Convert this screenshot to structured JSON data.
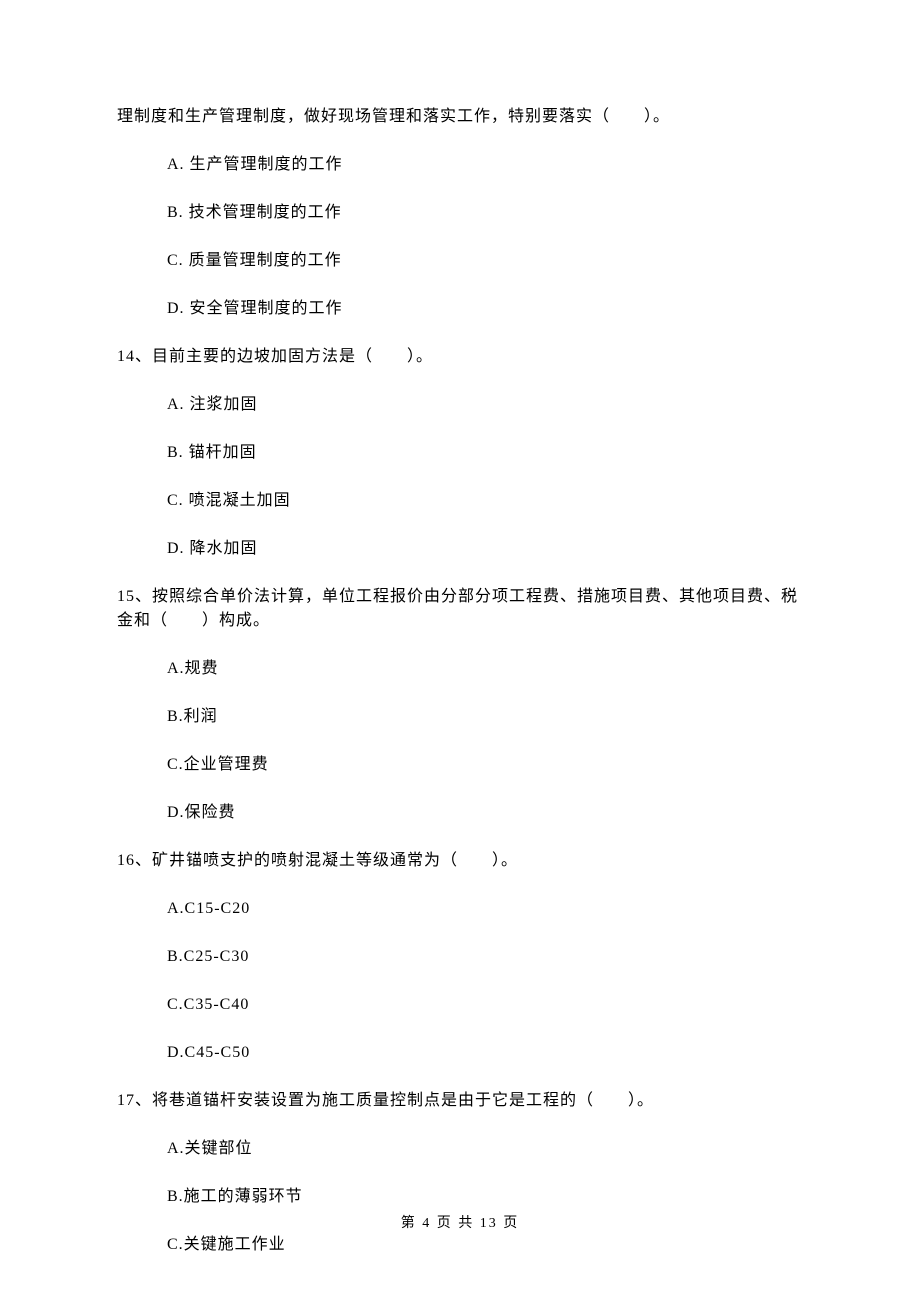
{
  "intro": "理制度和生产管理制度，做好现场管理和落实工作，特别要落实（　　）。",
  "q13_options": {
    "a": "A. 生产管理制度的工作",
    "b": "B. 技术管理制度的工作",
    "c": "C. 质量管理制度的工作",
    "d": "D. 安全管理制度的工作"
  },
  "q14": {
    "text": "14、目前主要的边坡加固方法是（　　）。",
    "a": "A. 注浆加固",
    "b": "B. 锚杆加固",
    "c": "C. 喷混凝土加固",
    "d": "D. 降水加固"
  },
  "q15": {
    "text": "15、按照综合单价法计算，单位工程报价由分部分项工程费、措施项目费、其他项目费、税金和（　　）构成。",
    "a": "A.规费",
    "b": "B.利润",
    "c": "C.企业管理费",
    "d": "D.保险费"
  },
  "q16": {
    "text": "16、矿井锚喷支护的喷射混凝土等级通常为（　　）。",
    "a": "A.C15-C20",
    "b": "B.C25-C30",
    "c": "C.C35-C40",
    "d": "D.C45-C50"
  },
  "q17": {
    "text": "17、将巷道锚杆安装设置为施工质量控制点是由于它是工程的（　　）。",
    "a": "A.关键部位",
    "b": "B.施工的薄弱环节",
    "c": "C.关键施工作业"
  },
  "footer": "第 4 页 共 13 页"
}
